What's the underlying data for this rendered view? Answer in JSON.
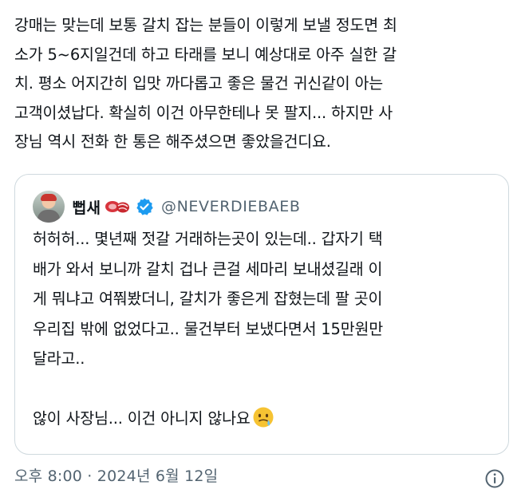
{
  "tweet": {
    "text": "강매는 맞는데 보통 갈치 잡는 분들이 이렇게 보낼 정도면 최\n소가 5~6지일건데 하고 타래를 보니 예상대로 아주 실한 갈\n치. 평소 어지간히 입맛 까다롭고 좋은 물건 귀신같이 아는\n고객이셨납다. 확실히 이건 아무한테나 못 팔지... 하지만 사\n장님 역시 전화 한 통은 해주셨으면 좋았을건디요.",
    "timestamp": "오후 8:00 · 2024년 6월 12일"
  },
  "quote": {
    "author_name": "뻡새",
    "handle": "@NEVERDIEBAEB",
    "text": "허허허... 몇년째 젓갈 거래하는곳이 있는데.. 갑자기 택\n배가 와서 보니까 갈치 겁나 큰걸 세마리 보내셨길래 이\n게 뭐냐고 여쭤봤더니, 갈치가 좋은게 잡혔는데 팔 곳이\n우리집 밖에 없었다고.. 물건부터 보냈다면서 15만원만\n달라고..\n\n않이 사장님... 이건 아니지 않나요",
    "emoji": "sweat-smile-emoji"
  },
  "icons": {
    "author_emoji": "meat-steak-icon",
    "verified": "verified-badge-icon",
    "info": "info-icon"
  },
  "colors": {
    "text": "#0f1419",
    "secondary": "#536471",
    "border": "#cfd9de",
    "verified": "#1d9bf0"
  }
}
